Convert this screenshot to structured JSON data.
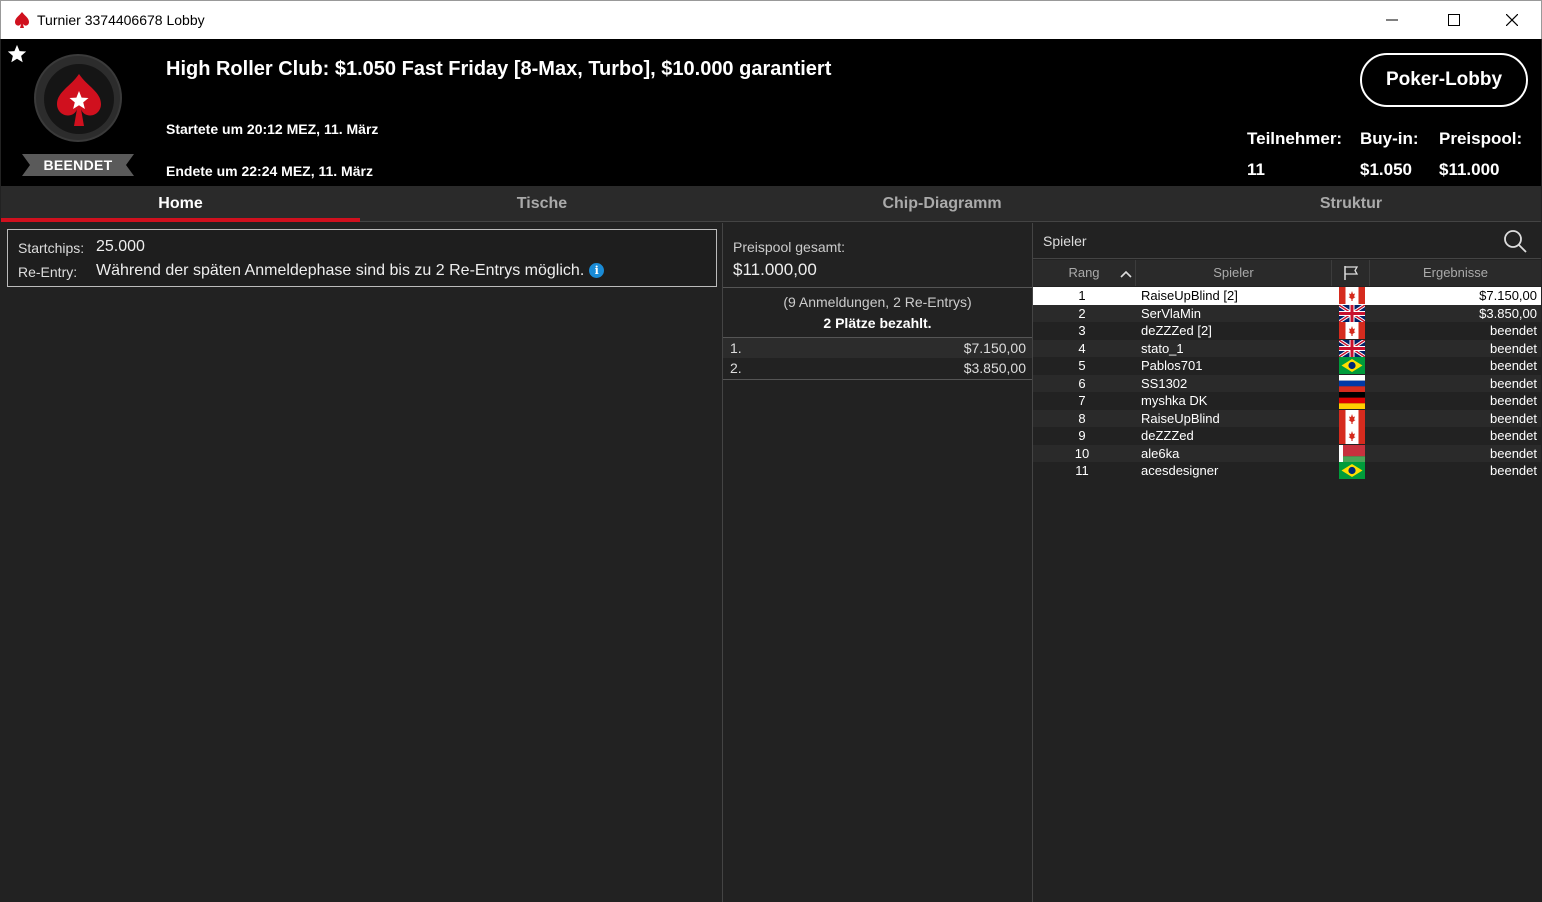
{
  "window": {
    "title": "Turnier 3374406678 Lobby",
    "minimize": "—",
    "maximize": "☐",
    "close": "✕"
  },
  "header": {
    "status": "BEENDET",
    "title": "High Roller Club: $1.050 Fast Friday [8-Max, Turbo], $10.000 garantiert",
    "started": "Startete um 20:12 MEZ, 11. März",
    "ended": "Endete um 22:24 MEZ, 11. März",
    "lobby_button": "Poker-Lobby",
    "stats": {
      "participants_label": "Teilnehmer:",
      "participants_value": "11",
      "buyin_label": "Buy-in:",
      "buyin_value": "$1.050",
      "prizepool_label": "Preispool:",
      "prizepool_value": "$11.000"
    }
  },
  "tabs": [
    {
      "label": "Home",
      "active": true
    },
    {
      "label": "Tische",
      "active": false
    },
    {
      "label": "Chip-Diagramm",
      "active": false
    },
    {
      "label": "Struktur",
      "active": false
    }
  ],
  "info": {
    "startchips_label": "Startchips:",
    "startchips_value": "25.000",
    "reentry_label": "Re-Entry:",
    "reentry_value": "Während der späten Anmeldephase sind bis zu 2 Re-Entrys möglich.",
    "info_icon": "i"
  },
  "prizepool": {
    "label": "Preispool gesamt:",
    "value": "$11.000,00",
    "registrations": "(9 Anmeldungen, 2 Re-Entrys)",
    "paid": "2 Plätze bezahlt.",
    "payouts": [
      {
        "pos": "1.",
        "amount": "$7.150,00"
      },
      {
        "pos": "2.",
        "amount": "$3.850,00"
      }
    ]
  },
  "players": {
    "search_label": "Spieler",
    "columns": {
      "rank": "Rang",
      "player": "Spieler",
      "result": "Ergebnisse"
    },
    "rows": [
      {
        "rank": "1",
        "name": "RaiseUpBlind [2]",
        "flag": "ca",
        "result": "$7.150,00"
      },
      {
        "rank": "2",
        "name": "SerVlaMin",
        "flag": "gb",
        "result": "$3.850,00"
      },
      {
        "rank": "3",
        "name": "deZZZed [2]",
        "flag": "ca",
        "result": "beendet"
      },
      {
        "rank": "4",
        "name": "stato_1",
        "flag": "gb",
        "result": "beendet"
      },
      {
        "rank": "5",
        "name": "Pablos701",
        "flag": "br",
        "result": "beendet"
      },
      {
        "rank": "6",
        "name": "SS1302",
        "flag": "ru",
        "result": "beendet"
      },
      {
        "rank": "7",
        "name": "myshka DK",
        "flag": "de",
        "result": "beendet"
      },
      {
        "rank": "8",
        "name": "RaiseUpBlind",
        "flag": "ca",
        "result": "beendet"
      },
      {
        "rank": "9",
        "name": "deZZZed",
        "flag": "ca",
        "result": "beendet"
      },
      {
        "rank": "10",
        "name": "ale6ka",
        "flag": "by",
        "result": "beendet"
      },
      {
        "rank": "11",
        "name": "acesdesigner",
        "flag": "br",
        "result": "beendet"
      }
    ]
  },
  "colors": {
    "accent_red": "#d0101e",
    "header_bg": "#000000",
    "panel_bg": "#222222",
    "info_blue": "#1a8bd6"
  }
}
